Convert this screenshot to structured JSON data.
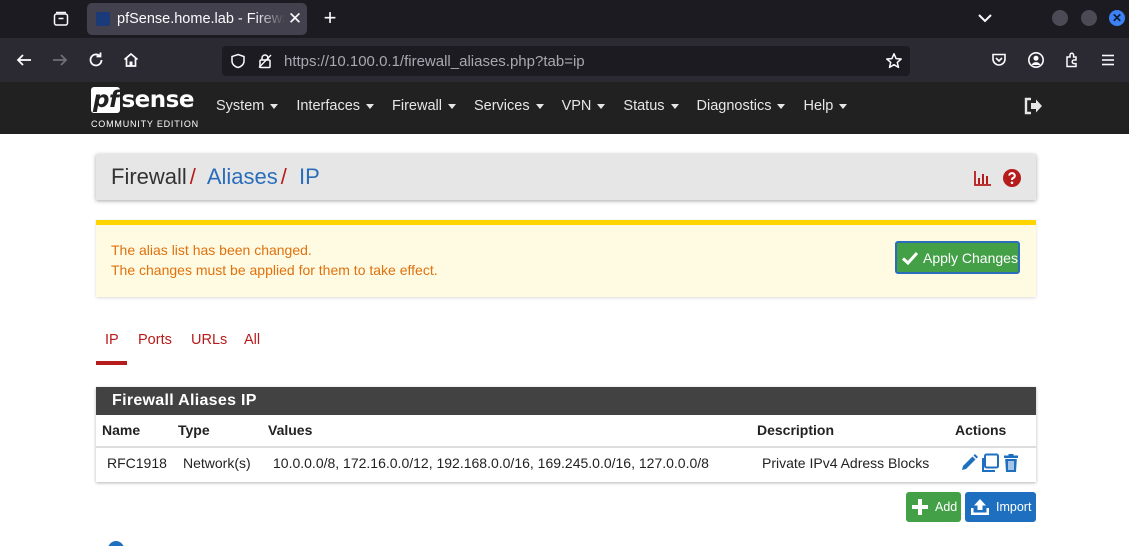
{
  "browser": {
    "tab_title": "pfSense.home.lab - Firewall: Aliases: IP",
    "url_host": "https://10.100.0.1",
    "url_path": "/firewall_aliases.php?tab=ip"
  },
  "header": {
    "logo_pf": "pf",
    "logo_sense": "sense",
    "logo_edition": "COMMUNITY EDITION",
    "menu": [
      {
        "label": "System"
      },
      {
        "label": "Interfaces"
      },
      {
        "label": "Firewall"
      },
      {
        "label": "Services"
      },
      {
        "label": "VPN"
      },
      {
        "label": "Status"
      },
      {
        "label": "Diagnostics"
      },
      {
        "label": "Help"
      }
    ]
  },
  "breadcrumb": {
    "root": "Firewall",
    "section": "Aliases",
    "page": "IP",
    "sep": "/"
  },
  "alert": {
    "line1": "The alias list has been changed.",
    "line2": "The changes must be applied for them to take effect.",
    "apply_label": "Apply Changes"
  },
  "tabs": [
    {
      "label": "IP",
      "active": true
    },
    {
      "label": "Ports"
    },
    {
      "label": "URLs"
    },
    {
      "label": "All"
    }
  ],
  "table": {
    "title": "Firewall Aliases IP",
    "columns": [
      "Name",
      "Type",
      "Values",
      "Description",
      "Actions"
    ],
    "rows": [
      {
        "name": "RFC1918",
        "type": "Network(s)",
        "values": "10.0.0.0/8, 172.16.0.0/12, 192.168.0.0/16, 169.245.0.0/16, 127.0.0.0/8",
        "description": "Private IPv4 Adress Blocks"
      }
    ]
  },
  "buttons": {
    "add": "Add",
    "import": "Import"
  },
  "colors": {
    "accent_red": "#b71c1c",
    "link_blue": "#2a6ebb",
    "success_green": "#43a047",
    "warning_text": "#e0710d",
    "warning_border": "#ffd500"
  }
}
